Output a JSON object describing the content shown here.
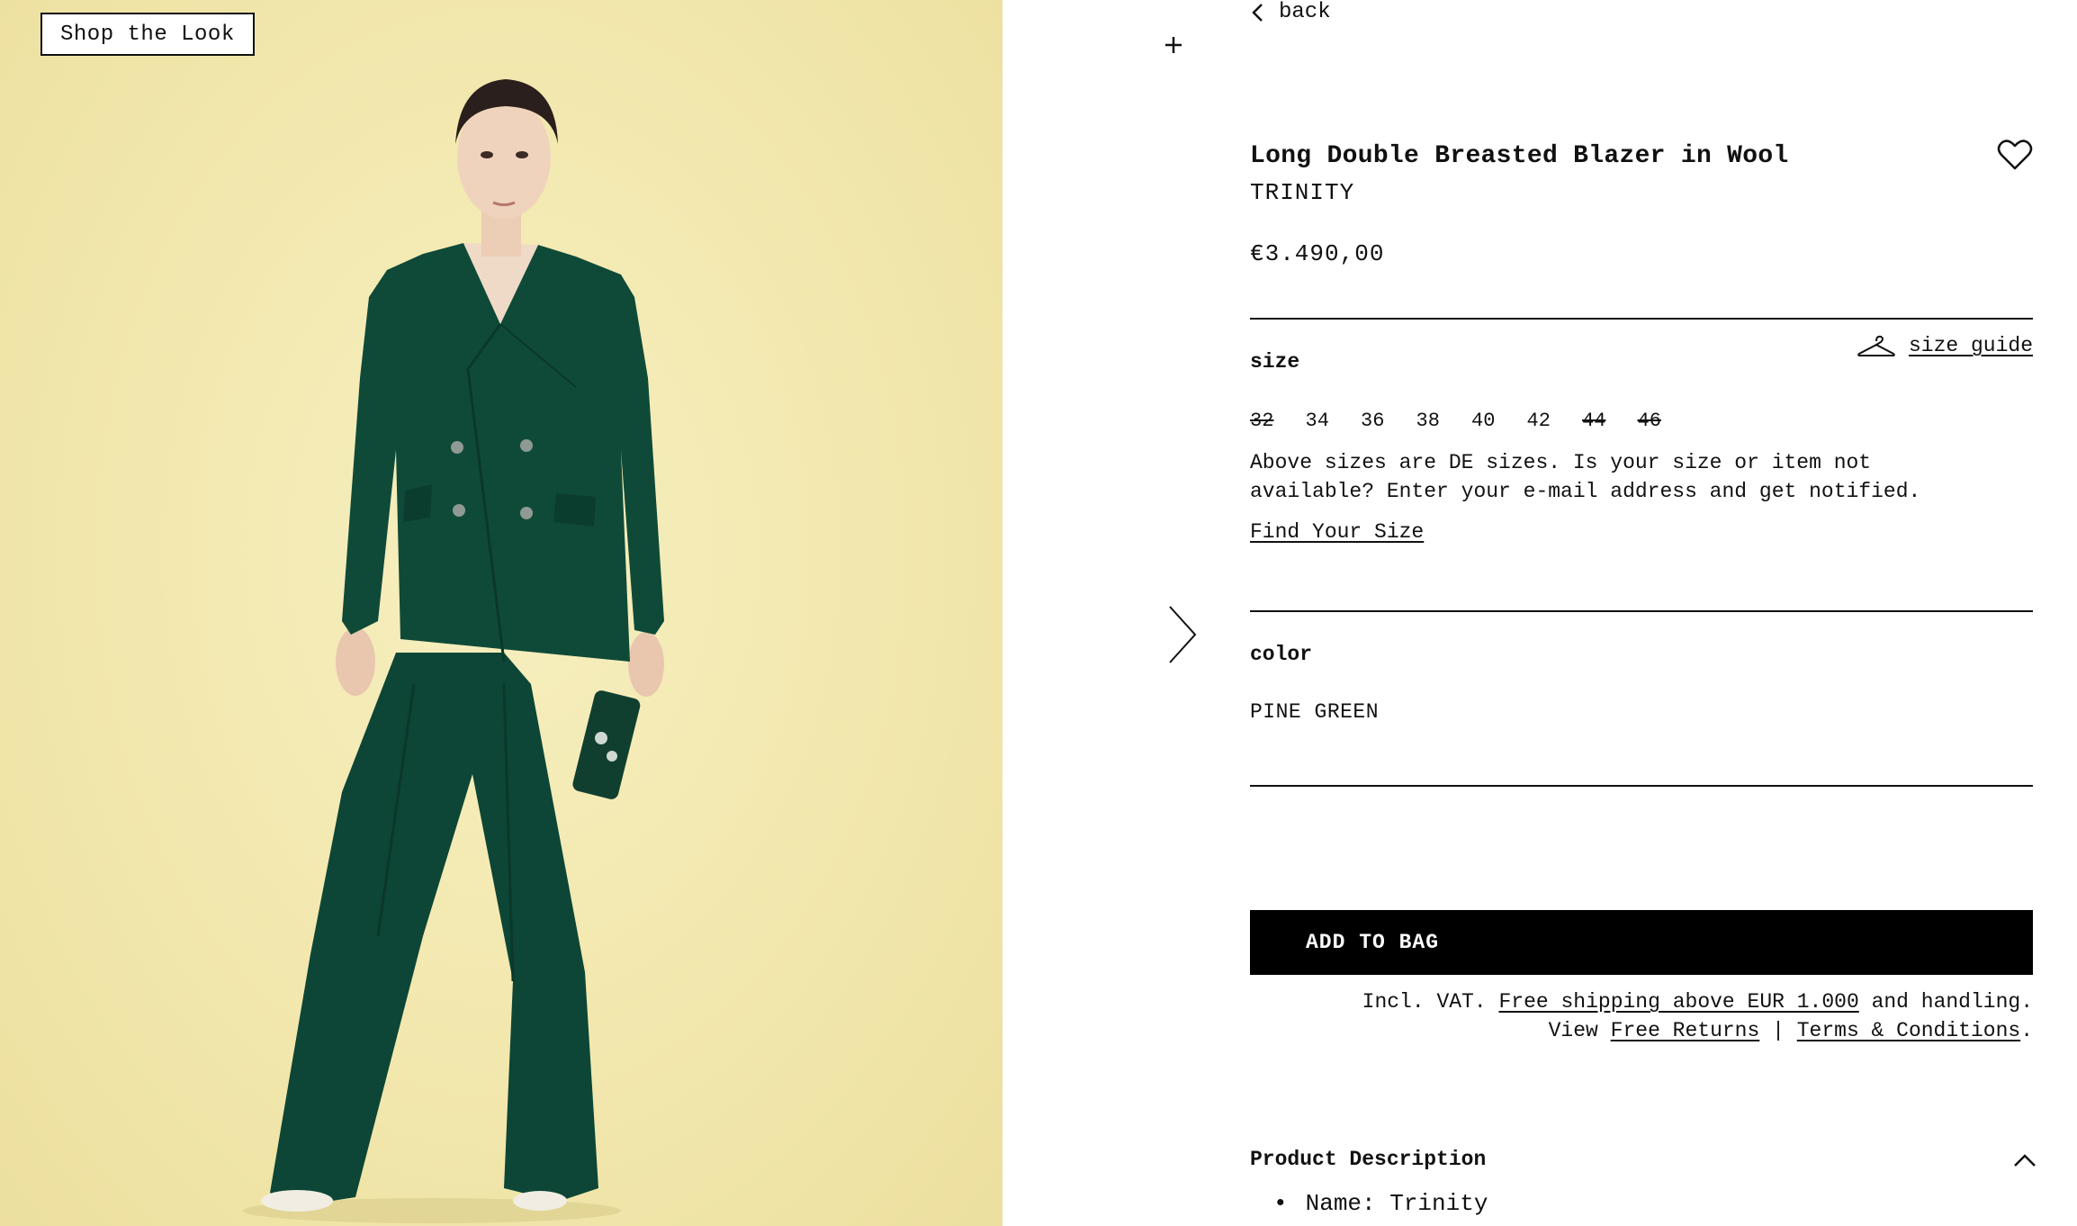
{
  "photo": {
    "shop_the_look_label": "Shop the Look",
    "background_color": "#f2e7ad",
    "garment_color": "#0f4a38"
  },
  "nav": {
    "back_label": "back"
  },
  "product": {
    "title": "Long Double Breasted Blazer in Wool",
    "brand": "TRINITY",
    "price": "€3.490,00"
  },
  "size": {
    "label": "size",
    "guide_label": "size guide",
    "options": [
      {
        "value": "32",
        "available": false
      },
      {
        "value": "34",
        "available": true
      },
      {
        "value": "36",
        "available": true
      },
      {
        "value": "38",
        "available": true
      },
      {
        "value": "40",
        "available": true
      },
      {
        "value": "42",
        "available": true
      },
      {
        "value": "44",
        "available": false
      },
      {
        "value": "46",
        "available": false
      }
    ],
    "note": "Above sizes are DE sizes. Is your size or item not available? Enter your e-mail address and get notified.",
    "find_size_label": "Find Your Size"
  },
  "color": {
    "label": "color",
    "value": "PINE GREEN"
  },
  "cart": {
    "add_to_bag_label": "ADD TO BAG"
  },
  "shipping": {
    "prefix": "Incl. VAT.",
    "free_shipping_link": "Free shipping above EUR 1.000",
    "suffix": "and handling.",
    "view_label": "View",
    "free_returns_link": "Free Returns",
    "separator": "|",
    "terms_link": "Terms & Conditions",
    "end": "."
  },
  "description": {
    "title": "Product Description",
    "items": [
      "Name: Trinity"
    ]
  }
}
